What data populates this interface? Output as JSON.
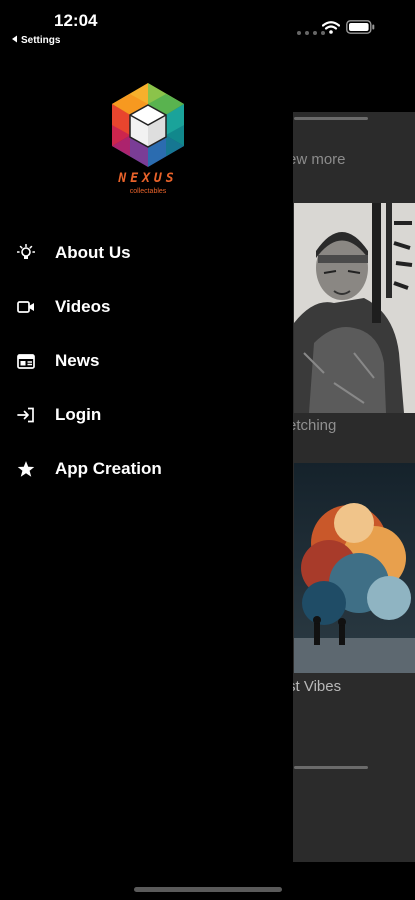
{
  "status_bar": {
    "time": "12:04",
    "back_label": "Settings"
  },
  "background": {
    "view_more": "ew more",
    "cards": [
      {
        "caption": "etching"
      },
      {
        "caption": "st Vibes"
      }
    ]
  },
  "logo": {
    "word": "NEXUS",
    "sub": "collectables"
  },
  "menu": {
    "items": [
      {
        "label": "About Us",
        "icon": "lightbulb-icon"
      },
      {
        "label": "Videos",
        "icon": "video-camera-icon"
      },
      {
        "label": "News",
        "icon": "newspaper-icon"
      },
      {
        "label": "Login",
        "icon": "login-icon"
      },
      {
        "label": "App Creation",
        "icon": "star-icon"
      }
    ]
  },
  "colors": {
    "brand_orange": "#e8622a",
    "drawer_bg": "#000000",
    "overlay_bg": "#2b2b2b"
  }
}
